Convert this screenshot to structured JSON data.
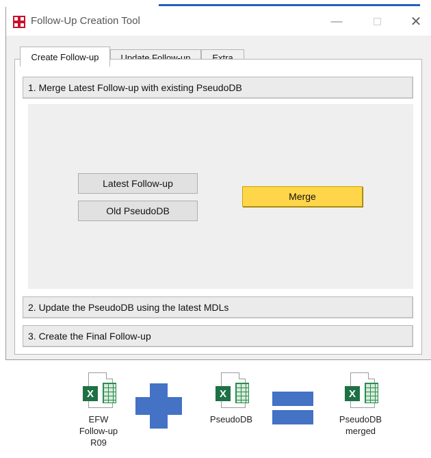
{
  "window": {
    "title": "Follow-Up Creation Tool",
    "min_glyph": "—",
    "close_glyph": "✕"
  },
  "tabs": [
    {
      "label": "Create Follow-up",
      "active": true
    },
    {
      "label": "Update Follow-up",
      "active": false
    },
    {
      "label": "Extra",
      "active": false
    }
  ],
  "sections": [
    {
      "label": "1. Merge Latest Follow-up with existing PseudoDB"
    },
    {
      "label": "2. Update the PseudoDB using the latest MDLs"
    },
    {
      "label": "3. Create the Final Follow-up"
    }
  ],
  "buttons": {
    "latest_followup": "Latest Follow-up",
    "old_pseudodb": "Old PseudoDB",
    "merge": "Merge"
  },
  "diagram": {
    "file_glyph": "X",
    "files": [
      {
        "label": "EFW\nFollow-up\nR09"
      },
      {
        "label": "PseudoDB"
      },
      {
        "label": "PseudoDB\nmerged"
      }
    ]
  },
  "colors": {
    "accent": "#4472c4",
    "merge_button": "#ffd54a",
    "excel_green": "#1e7145"
  }
}
